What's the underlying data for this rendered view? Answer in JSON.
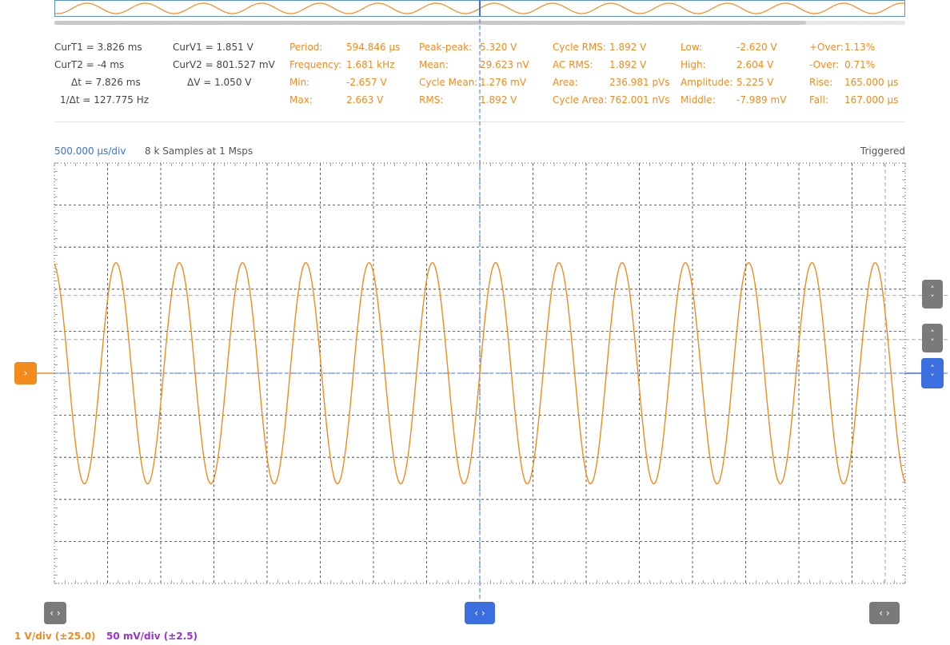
{
  "cursors": {
    "curt1": "CurT1 = 3.826 ms",
    "curt2": "CurT2 = -4 ms",
    "dt": "Δt = 7.826 ms",
    "inv_dt": "1/Δt = 127.775 Hz",
    "curv1": "CurV1 = 1.851 V",
    "curv2": "CurV2 = 801.527 mV",
    "dv": "ΔV =  1.050 V"
  },
  "measurements": {
    "period": {
      "label": "Period:",
      "value": "594.846 µs"
    },
    "frequency": {
      "label": "Frequency:",
      "value": "1.681 kHz"
    },
    "min": {
      "label": "Min:",
      "value": "-2.657 V"
    },
    "max": {
      "label": "Max:",
      "value": "2.663 V"
    },
    "peak_peak": {
      "label": "Peak-peak:",
      "value": "5.320 V"
    },
    "mean": {
      "label": "Mean:",
      "value": "29.623 nV"
    },
    "cycle_mean": {
      "label": "Cycle Mean:",
      "value": "1.276 mV"
    },
    "rms": {
      "label": "RMS:",
      "value": "1.892 V"
    },
    "cycle_rms": {
      "label": "Cycle RMS:",
      "value": "1.892 V"
    },
    "ac_rms": {
      "label": "AC RMS:",
      "value": "1.892 V"
    },
    "area": {
      "label": "Area:",
      "value": "236.981 pVs"
    },
    "cycle_area": {
      "label": "Cycle Area:",
      "value": "762.001 nVs"
    },
    "low": {
      "label": "Low:",
      "value": "-2.620 V"
    },
    "high": {
      "label": "High:",
      "value": "2.604 V"
    },
    "amplitude": {
      "label": "Amplitude:",
      "value": "5.225 V"
    },
    "middle": {
      "label": "Middle:",
      "value": "-7.989 mV"
    },
    "pos_over": {
      "label": "+Over:",
      "value": "1.13%"
    },
    "neg_over": {
      "label": "-Over:",
      "value": "0.71%"
    },
    "rise": {
      "label": "Rise:",
      "value": "165.000 µs"
    },
    "fall": {
      "label": "Fall:",
      "value": "167.000 µs"
    }
  },
  "timebase": "500.000 µs/div",
  "samples": "8 k Samples at 1 Msps",
  "trigger_status": "Triggered",
  "channels": {
    "ch1": {
      "label": "1 V/div (±25.0)",
      "color": "#f28a1c"
    },
    "ch2": {
      "label": "50 mV/div (±2.5)",
      "color": "#9b30d9"
    }
  },
  "icons": {
    "left_right": "‹ ›",
    "up": "˄",
    "down": "˅",
    "arrow_right": "›"
  },
  "colors": {
    "waveform": "#f28a1c",
    "trigger": "#3b6fe0",
    "grid": "#333333",
    "cursor": "#aaaaaa"
  },
  "signal": {
    "amplitude_v": 2.63,
    "period_us": 594.846,
    "volts_per_div": 1,
    "time_per_div_us": 500,
    "h_divisions": 16,
    "v_divisions": 10,
    "trigger_level_v": 0,
    "cursor_v1": 1.851,
    "cursor_v2": 0.801527
  }
}
